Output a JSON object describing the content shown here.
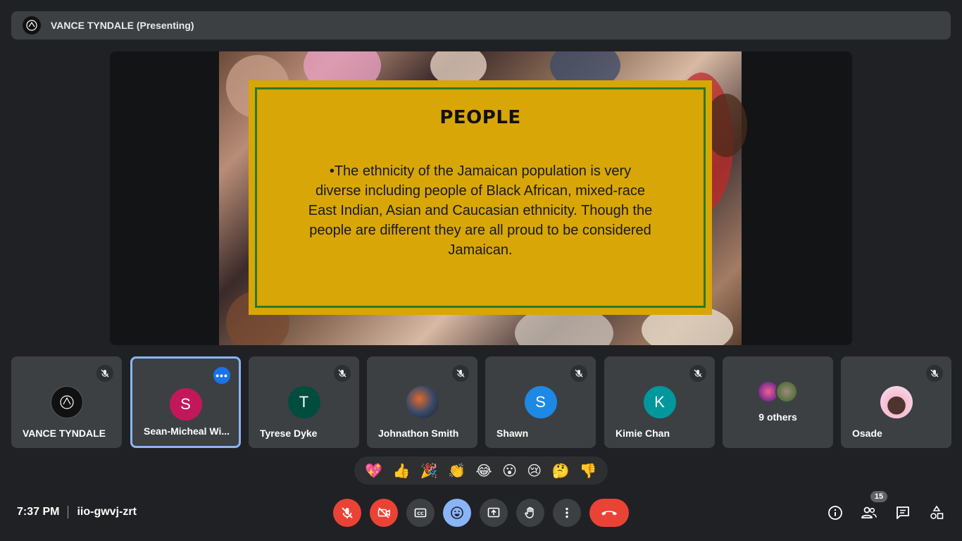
{
  "presenter_bar": {
    "title": "VANCE TYNDALE (Presenting)"
  },
  "slide": {
    "heading": "PEOPLE",
    "body": "•The ethnicity of the Jamaican population is very diverse including people of Black African, mixed-race East Indian, Asian and Caucasian ethnicity. Though the people are different they are all proud to be considered Jamaican."
  },
  "participants": [
    {
      "name": "VANCE TYNDALE",
      "initial": "",
      "color": "#111111",
      "muted": true
    },
    {
      "name": "Sean-Micheal Wi...",
      "initial": "S",
      "color": "#c2185b",
      "muted": false,
      "selected": true
    },
    {
      "name": "Tyrese Dyke",
      "initial": "T",
      "color": "#004d40",
      "muted": true
    },
    {
      "name": "Johnathon Smith",
      "initial": "",
      "color": "#2b3036",
      "muted": true
    },
    {
      "name": "Shawn",
      "initial": "S",
      "color": "#1e88e5",
      "muted": true
    },
    {
      "name": "Kimie Chan",
      "initial": "K",
      "color": "#00979d",
      "muted": true
    },
    {
      "name": "",
      "others_label": "9 others",
      "initial": "",
      "color": "#3c4043",
      "muted": false
    },
    {
      "name": "Osade",
      "initial": "",
      "color": "#f3e5f5",
      "muted": true
    }
  ],
  "reactions": [
    "💖",
    "👍",
    "🎉",
    "👏",
    "😂",
    "😮",
    "😢",
    "🤔",
    "👎"
  ],
  "footer": {
    "time": "7:37 PM",
    "meeting_code": "iio-gwvj-zrt",
    "participant_count": "15"
  },
  "colors": {
    "background": "#202124",
    "tile": "#3c4043",
    "accent": "#8ab4f8",
    "danger": "#ea4335",
    "slide_card": "#d8a606",
    "slide_border": "#2a7a26"
  }
}
